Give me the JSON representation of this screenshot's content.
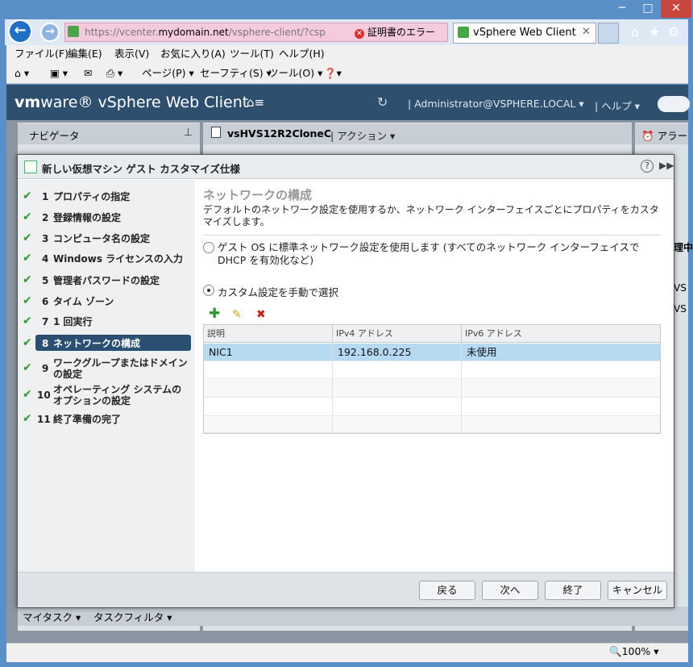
{
  "browser": {
    "address_prefix": "https://vcenter.",
    "address_domain": "mydomain.net",
    "address_suffix": "/vsphere-client/?csp",
    "cert_error": "証明書のエラー",
    "tab_title": "vSphere Web Client",
    "menu": [
      "ファイル(F)",
      "編集(E)",
      "表示(V)",
      "お気に入り(A)",
      "ツール(T)",
      "ヘルプ(H)"
    ],
    "commands": [
      "ページ(P)",
      "セーフティ(S)",
      "ツール(O)"
    ],
    "zoom": "100%"
  },
  "vsphere": {
    "logo_vm": "vm",
    "logo_rest": "ware® vSphere Web Client",
    "user": "Administrator@VSPHERE.LOCAL",
    "help": "ヘルプ",
    "navigator_title": "ナビゲータ",
    "object_title": "vsHVS12R2CloneC",
    "actions": "アクション",
    "alarm_title": "アラー",
    "task_tab1": "マイタスク",
    "task_tab2": "タスクフィルタ",
    "right_frag1": "理中",
    "right_frag2": "VS",
    "right_frag3": "VS"
  },
  "dialog": {
    "title": "新しい仮想マシン ゲスト カスタマイズ仕様",
    "steps": [
      {
        "num": "1",
        "label": "プロパティの指定"
      },
      {
        "num": "2",
        "label": "登録情報の設定"
      },
      {
        "num": "3",
        "label": "コンピュータ名の設定"
      },
      {
        "num": "4",
        "label": "Windows ライセンスの入力"
      },
      {
        "num": "5",
        "label": "管理者パスワードの設定"
      },
      {
        "num": "6",
        "label": "タイム ゾーン"
      },
      {
        "num": "7",
        "label": "1 回実行"
      },
      {
        "num": "8",
        "label": "ネットワークの構成"
      },
      {
        "num": "9",
        "label": "ワークグループまたはドメインの設定"
      },
      {
        "num": "10",
        "label": "オペレーティング システムのオプションの設定"
      },
      {
        "num": "11",
        "label": "終了準備の完了"
      }
    ],
    "content_title": "ネットワークの構成",
    "content_desc": "デフォルトのネットワーク設定を使用するか、ネットワーク インターフェイスごとにプロパティをカスタマイズします。",
    "radio_standard": "ゲスト OS に標準ネットワーク設定を使用します (すべてのネットワーク インターフェイスで DHCP を有効化など)",
    "radio_custom": "カスタム設定を手動で選択",
    "table": {
      "headers": [
        "説明",
        "IPv4 アドレス",
        "IPv6 アドレス"
      ],
      "rows": [
        [
          "NIC1",
          "192.168.0.225",
          "未使用"
        ]
      ]
    },
    "buttons": {
      "back": "戻る",
      "next": "次へ",
      "finish": "終了",
      "cancel": "キャンセル"
    }
  }
}
